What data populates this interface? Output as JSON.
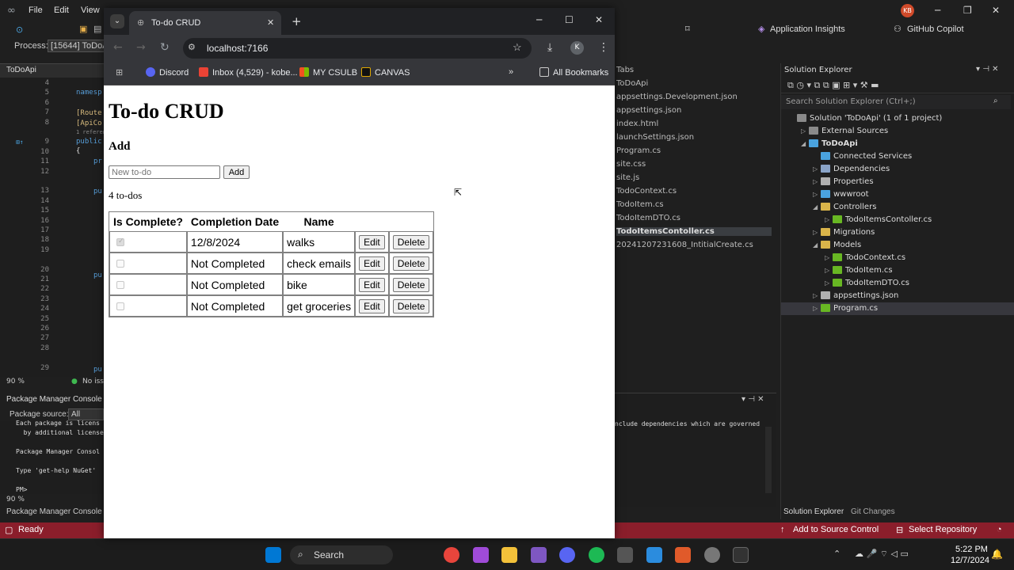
{
  "vs": {
    "menu": [
      "File",
      "Edit",
      "View"
    ],
    "process_label": "Process:",
    "process_value": "[15644] ToDoAp",
    "app_insights": "Application Insights",
    "copilot": "GitHub Copilot",
    "user_initials": "KB",
    "code_tab": "ToDoApi",
    "line_numbers": [
      "4",
      "5",
      "6",
      "7",
      "8",
      "",
      "9",
      "10",
      "11",
      "12",
      "",
      "13",
      "14",
      "15",
      "16",
      "17",
      "18",
      "19",
      "",
      "20",
      "21",
      "22",
      "23",
      "24",
      "25",
      "26",
      "27",
      "28",
      "",
      "29"
    ],
    "code_snippets": {
      "namespace": "namesp",
      "route": "[Route",
      "apicon": "[ApiCo",
      "refs": "1 referenc",
      "public": "public",
      "brace": "{",
      "pr": "pr",
      "pu": "pu"
    },
    "zoom": "90 %",
    "no_issues": "No iss",
    "pmc_title": "Package Manager Console",
    "pmc_source_label": "Package source:",
    "pmc_source_value": "All",
    "pmc_lines": [
      "Each package is licens",
      "  by additional license",
      "",
      "Package Manager Consol",
      "",
      "Type 'get-help NuGet'",
      "",
      "PM>"
    ],
    "pmc_zoom": "90 %",
    "pmc_footer": "Package Manager Console",
    "output_line": "nclude dependencies which are governed",
    "open_files": [
      "Tabs",
      "ToDoApi",
      "appsettings.Development.json",
      "appsettings.json",
      "index.html",
      "launchSettings.json",
      "Program.cs",
      "site.css",
      "site.js",
      "TodoContext.cs",
      "TodoItem.cs",
      "TodoItemDTO.cs",
      "TodoItemsContoller.cs",
      "20241207231608_IntitialCreate.cs"
    ],
    "solution_explorer": {
      "title": "Solution Explorer",
      "search_placeholder": "Search Solution Explorer (Ctrl+;)",
      "items": [
        {
          "label": "Solution 'ToDoApi' (1 of 1 project)",
          "depth": 0,
          "icon": "solution-icon",
          "arrow": ""
        },
        {
          "label": "External Sources",
          "depth": 1,
          "icon": "external-sources-icon",
          "arrow": "▷"
        },
        {
          "label": "ToDoApi",
          "depth": 1,
          "icon": "project-icon",
          "arrow": "◢",
          "bold": true
        },
        {
          "label": "Connected Services",
          "depth": 2,
          "icon": "connected-services-icon",
          "arrow": ""
        },
        {
          "label": "Dependencies",
          "depth": 2,
          "icon": "dependencies-icon",
          "arrow": "▷"
        },
        {
          "label": "Properties",
          "depth": 2,
          "icon": "properties-icon",
          "arrow": "▷"
        },
        {
          "label": "wwwroot",
          "depth": 2,
          "icon": "globe-icon",
          "arrow": "▷"
        },
        {
          "label": "Controllers",
          "depth": 2,
          "icon": "folder-icon",
          "arrow": "◢"
        },
        {
          "label": "TodoItemsContoller.cs",
          "depth": 3,
          "icon": "csharp-file-icon",
          "arrow": "▷"
        },
        {
          "label": "Migrations",
          "depth": 2,
          "icon": "folder-icon",
          "arrow": "▷"
        },
        {
          "label": "Models",
          "depth": 2,
          "icon": "folder-icon",
          "arrow": "◢"
        },
        {
          "label": "TodoContext.cs",
          "depth": 3,
          "icon": "csharp-file-icon",
          "arrow": "▷"
        },
        {
          "label": "TodoItem.cs",
          "depth": 3,
          "icon": "csharp-file-icon",
          "arrow": "▷"
        },
        {
          "label": "TodoItemDTO.cs",
          "depth": 3,
          "icon": "csharp-file-icon",
          "arrow": "▷"
        },
        {
          "label": "appsettings.json",
          "depth": 2,
          "icon": "json-file-icon",
          "arrow": "▷"
        },
        {
          "label": "Program.cs",
          "depth": 2,
          "icon": "csharp-file-icon",
          "arrow": "▷",
          "selected": true
        }
      ],
      "tabs": [
        "Solution Explorer",
        "Git Changes"
      ]
    },
    "status": {
      "ready": "Ready",
      "source_control": "Add to Source Control",
      "repository": "Select Repository"
    }
  },
  "browser": {
    "tab_title": "To-do CRUD",
    "url": "localhost:7166",
    "profile_initial": "K",
    "bookmarks": [
      "Discord",
      "Inbox (4,529) - kobe...",
      "MY CSULB",
      "CANVAS"
    ],
    "all_bookmarks": "All Bookmarks"
  },
  "page": {
    "title": "To-do CRUD",
    "add_heading": "Add",
    "input_placeholder": "New to-do",
    "add_button": "Add",
    "count_text": "4 to-dos",
    "columns": [
      "Is Complete?",
      "Completion Date",
      "Name"
    ],
    "edit_label": "Edit",
    "delete_label": "Delete",
    "rows": [
      {
        "complete": true,
        "date": "12/8/2024",
        "name": "walks"
      },
      {
        "complete": false,
        "date": "Not Completed",
        "name": "check emails"
      },
      {
        "complete": false,
        "date": "Not Completed",
        "name": "bike"
      },
      {
        "complete": false,
        "date": "Not Completed",
        "name": "get groceries"
      }
    ]
  },
  "taskbar": {
    "search": "Search",
    "time": "5:22 PM",
    "date": "12/7/2024"
  }
}
